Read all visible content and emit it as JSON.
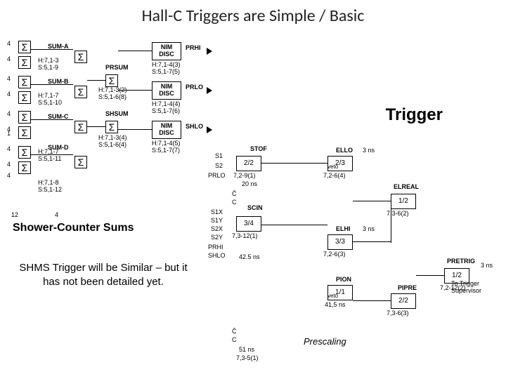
{
  "title": "Hall-C Triggers are Simple / Basic",
  "labels": {
    "trigger": "Trigger",
    "shower": "Shower-Counter Sums",
    "shms_note": "SHMS Trigger will be Similar – but it has not been detailed yet."
  },
  "sigma": "Σ",
  "left_groups": [
    {
      "name": "SUM-A",
      "detail": "H:7,1-3\nS:5,1-9"
    },
    {
      "name": "SUM-B",
      "detail": "H:7,1-7\nS:5,1-10"
    },
    {
      "name": "SUM-C",
      "detail": "H:7,1-7\nS:5,1-11"
    },
    {
      "name": "SUM-D",
      "detail": "H:7,1-8\nS:5,1-12"
    }
  ],
  "left_counts": {
    "col1": [
      "4",
      "4",
      "4",
      "4",
      "4",
      "4",
      "1",
      "4",
      "4",
      "4",
      "4",
      "4"
    ],
    "bottom": "12",
    "bottom2": "4"
  },
  "mid_blocks": {
    "prsum": {
      "label": "PRSUM",
      "detail": "H:7,1-3(2)\nS:5,1-6(8)"
    },
    "shsum": {
      "label": "SHSUM",
      "detail": "H:7,1-3(4)\nS:5,1-6(4)"
    }
  },
  "nim_discs": [
    {
      "out": "PRHI",
      "detail": "H:7,1-4(3)\nS:5,1-7(5)"
    },
    {
      "out": "PRLO",
      "detail": "H:7,1-4(4)\nS:5,1-7(6)"
    },
    {
      "out": "SHLO",
      "detail": "H:7,1-4(5)\nS:5,1-7(7)"
    }
  ],
  "nim_label": "NIM\nDISC",
  "scint": {
    "inputs": [
      "S1",
      "S2",
      "PRLO"
    ],
    "gate": "2/2",
    "detail": "7,2-9(1)",
    "delay": "20 ns",
    "stof": "STOF",
    "scin": "SCIN",
    "s_lines": [
      "S1X",
      "S1Y",
      "S2X",
      "S2Y",
      "PRHI",
      "SHLO"
    ],
    "gate2": "3/4",
    "detail2": "7,3-12(1)",
    "delay2": "42.5 ns",
    "cer": "C",
    "barc": "C̄"
  },
  "right_blocks": {
    "ello": {
      "name": "ELLO",
      "gate": "2/3",
      "sub": "7,2-6(4)",
      "note": "veto",
      "delay": "3 ns"
    },
    "elhi": {
      "name": "ELHI",
      "gate": "3/3",
      "sub": "7,2-6(3)",
      "delay": "3 ns"
    },
    "elreal": {
      "name": "ELREAL",
      "gate": "1/2",
      "sub": "7,3-6(2)"
    },
    "pion": {
      "name": "PION",
      "gate": "1/1",
      "sub": "41,5 ns",
      "note": "veto"
    },
    "pipre": {
      "name": "PIPRE",
      "gate": "2/2",
      "sub": "7,3-6(3)"
    },
    "pretrig": {
      "name": "PRETRIG",
      "gate": "1/2",
      "sub": "7,2-12(2)",
      "note": "3 ns",
      "to": "To Trigger\nSupervisor"
    }
  },
  "bottom": {
    "delay": "51 ns",
    "sub": "7,3-5(1)",
    "prescaling": "Prescaling",
    "cbar": "C̄",
    "c": "C"
  }
}
